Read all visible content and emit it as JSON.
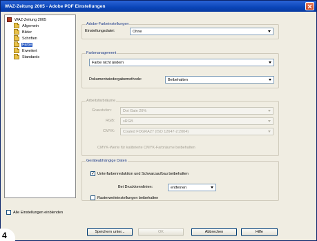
{
  "window": {
    "title": "WAZ-Zeitung 2005 - Adobe PDF Einstellungen"
  },
  "tree": {
    "root": "WAZ-Zeitung 2005",
    "items": [
      "Allgemein",
      "Bilder",
      "Schriften",
      "Farbe",
      "Erweitert",
      "Standards"
    ],
    "selected_index": 3
  },
  "adobe_color": {
    "legend": "Adobe-Farbeinstellungen",
    "settings_label": "Einstellungsdatei:",
    "settings_value": "Ohne"
  },
  "color_management": {
    "legend": "Farbmanagement",
    "policy_value": "Farbe nicht ändern",
    "intent_label": "Dokumentwiedergabemethode:",
    "intent_value": "Beibehalten"
  },
  "working_spaces": {
    "legend": "Arbeitsfarbräume",
    "gray_label": "Graustufen:",
    "gray_value": "Dot Gain 20%",
    "rgb_label": "RGB:",
    "rgb_value": "sRGB",
    "cmyk_label": "CMYK:",
    "cmyk_value": "Coated FOGRA27 (ISO 12647-2:2004)",
    "cmyk_preserve_label": "CMYK-Werte für kalibrierte CMYK-Farbräume beibehalten"
  },
  "device_dependent": {
    "legend": "Geräteabhängige Daten",
    "overprint_label": "Unterfarbenreduktion und Schwarzaufbau beibehalten",
    "overprint_checked": true,
    "transfer_label": "Bei Druckkennlinien:",
    "transfer_value": "entfernen",
    "halftone_label": "Rasterweiteinstellungen beibehalten",
    "halftone_checked": false
  },
  "show_all": {
    "label": "Alle Einstellungen einblenden",
    "checked": false
  },
  "buttons": {
    "save": "Speichern unter...",
    "ok": "OK",
    "cancel": "Abbrechen",
    "help": "Hilfe"
  },
  "badge": {
    "number": "4"
  }
}
